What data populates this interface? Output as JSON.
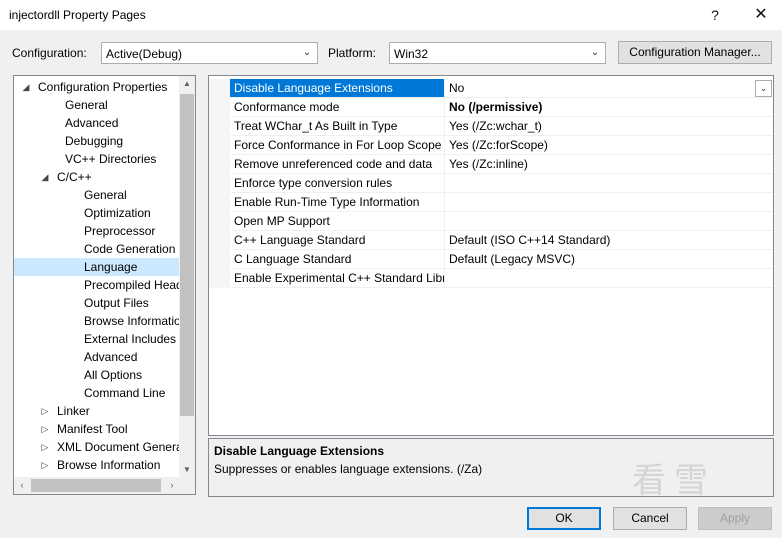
{
  "window": {
    "title": "injectordll Property Pages",
    "help": "?",
    "close": "✕"
  },
  "toolbar": {
    "configuration_label": "Configuration:",
    "configuration_value": "Active(Debug)",
    "platform_label": "Platform:",
    "platform_value": "Win32",
    "config_manager": "Configuration Manager..."
  },
  "tree": [
    {
      "label": "Configuration Properties",
      "level": 0,
      "expander": "expanded"
    },
    {
      "label": "General",
      "level": 1
    },
    {
      "label": "Advanced",
      "level": 1
    },
    {
      "label": "Debugging",
      "level": 1
    },
    {
      "label": "VC++ Directories",
      "level": 1
    },
    {
      "label": "C/C++",
      "level": 1,
      "expander": "expanded"
    },
    {
      "label": "General",
      "level": 2
    },
    {
      "label": "Optimization",
      "level": 2
    },
    {
      "label": "Preprocessor",
      "level": 2
    },
    {
      "label": "Code Generation",
      "level": 2
    },
    {
      "label": "Language",
      "level": 2,
      "selected": true
    },
    {
      "label": "Precompiled Heade",
      "level": 2
    },
    {
      "label": "Output Files",
      "level": 2
    },
    {
      "label": "Browse Information",
      "level": 2
    },
    {
      "label": "External Includes",
      "level": 2
    },
    {
      "label": "Advanced",
      "level": 2
    },
    {
      "label": "All Options",
      "level": 2
    },
    {
      "label": "Command Line",
      "level": 2
    },
    {
      "label": "Linker",
      "level": 1,
      "expander": "collapsed"
    },
    {
      "label": "Manifest Tool",
      "level": 1,
      "expander": "collapsed"
    },
    {
      "label": "XML Document Genera",
      "level": 1,
      "expander": "collapsed"
    },
    {
      "label": "Browse Information",
      "level": 1,
      "expander": "collapsed"
    }
  ],
  "properties": [
    {
      "name": "Disable Language Extensions",
      "value": "No",
      "selected": true
    },
    {
      "name": "Conformance mode",
      "value": "No (/permissive)",
      "bold": true
    },
    {
      "name": "Treat WChar_t As Built in Type",
      "value": "Yes (/Zc:wchar_t)"
    },
    {
      "name": "Force Conformance in For Loop Scope",
      "value": "Yes (/Zc:forScope)"
    },
    {
      "name": "Remove unreferenced code and data",
      "value": "Yes (/Zc:inline)"
    },
    {
      "name": "Enforce type conversion rules",
      "value": ""
    },
    {
      "name": "Enable Run-Time Type Information",
      "value": ""
    },
    {
      "name": "Open MP Support",
      "value": ""
    },
    {
      "name": "C++ Language Standard",
      "value": "Default (ISO C++14 Standard)"
    },
    {
      "name": "C Language Standard",
      "value": "Default (Legacy MSVC)"
    },
    {
      "name": "Enable Experimental C++ Standard Libra",
      "value": ""
    }
  ],
  "description": {
    "title": "Disable Language Extensions",
    "text": "Suppresses or enables language extensions.      (/Za)"
  },
  "buttons": {
    "ok": "OK",
    "cancel": "Cancel",
    "apply": "Apply"
  },
  "watermark": "看雪"
}
